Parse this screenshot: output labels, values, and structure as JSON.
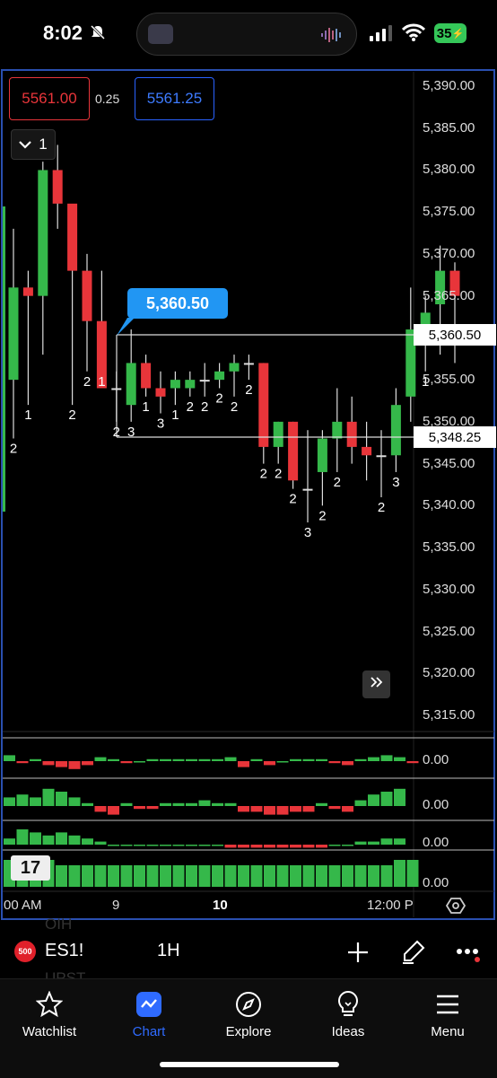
{
  "status_bar": {
    "time": "8:02",
    "battery": "35"
  },
  "chart": {
    "bid_price": "5561.00",
    "tick_size": "0.25",
    "ask_price": "5561.25",
    "collapse_label": "1",
    "price_labels": [
      "5,390.00",
      "5,385.00",
      "5,380.00",
      "5,375.00",
      "5,370.00",
      "5,365.00",
      "5,360.00",
      "5,355.00",
      "5,350.00",
      "5,345.00",
      "5,340.00",
      "5,335.00",
      "5,330.00",
      "5,325.00",
      "5,320.00",
      "5,315.00"
    ],
    "highlight_upper": "5,360.50",
    "highlight_lower": "5,348.25",
    "callout": "5,360.50",
    "candle_counts": [
      "2",
      "1",
      "2",
      "2",
      "1",
      "2",
      "3",
      "1",
      "3",
      "1",
      "2",
      "2",
      "2",
      "2",
      "2",
      "2",
      "2",
      "2",
      "3",
      "2",
      "2",
      "2",
      "3",
      "1"
    ],
    "indicator_values": [
      "0.00",
      "0.00",
      "0.00",
      "0.00"
    ],
    "time_labels": [
      "00 AM",
      "9",
      "10",
      "12:00 P"
    ],
    "colors": {
      "up": "#35b84a",
      "down": "#e8353a",
      "accent": "#2962ff",
      "callout": "#2196f3"
    },
    "ohlc": [
      [
        5355,
        5373,
        5348,
        5366
      ],
      [
        5366,
        5368,
        5352,
        5365
      ],
      [
        5365,
        5381,
        5358,
        5380
      ],
      [
        5380,
        5383,
        5373,
        5376
      ],
      [
        5376,
        5375,
        5352,
        5368
      ],
      [
        5368,
        5370,
        5356,
        5362
      ],
      [
        5362,
        5368,
        5356,
        5354
      ],
      [
        5354,
        5356,
        5350,
        5354
      ],
      [
        5352,
        5361,
        5350,
        5357
      ],
      [
        5357,
        5358,
        5353,
        5354
      ],
      [
        5354,
        5356,
        5351,
        5353
      ],
      [
        5354,
        5356,
        5352,
        5355
      ],
      [
        5354,
        5356,
        5353,
        5355
      ],
      [
        5355,
        5357,
        5353,
        5355
      ],
      [
        5355,
        5357,
        5354,
        5356
      ],
      [
        5356,
        5358,
        5353,
        5357
      ],
      [
        5357,
        5358,
        5355,
        5357
      ],
      [
        5357,
        5357,
        5345,
        5347
      ],
      [
        5347,
        5350,
        5345,
        5350
      ],
      [
        5350,
        5350,
        5342,
        5343
      ],
      [
        5342,
        5349,
        5338,
        5342
      ],
      [
        5344,
        5349,
        5340,
        5348
      ],
      [
        5348,
        5354,
        5344,
        5350
      ],
      [
        5350,
        5353,
        5345,
        5347
      ],
      [
        5347,
        5350,
        5343,
        5346
      ],
      [
        5346,
        5349,
        5341,
        5346
      ],
      [
        5346,
        5354,
        5344,
        5352
      ],
      [
        5353,
        5366,
        5350,
        5361
      ],
      [
        5361,
        5365,
        5356,
        5363
      ],
      [
        5364,
        5371,
        5358,
        5368
      ],
      [
        5368,
        5369,
        5357,
        5365
      ]
    ],
    "osc1": [
      3,
      -1,
      1,
      -2,
      -3,
      -4,
      -2,
      2,
      1,
      -1,
      0,
      1,
      1,
      1,
      1,
      1,
      1,
      2,
      -3,
      1,
      -2,
      0,
      1,
      1,
      1,
      -1,
      -2,
      1,
      2,
      3,
      2,
      -1
    ],
    "osc2": [
      3,
      4,
      3,
      6,
      5,
      3,
      1,
      -2,
      -3,
      1,
      -1,
      -1,
      1,
      1,
      1,
      2,
      1,
      1,
      -2,
      -2,
      -3,
      -3,
      -2,
      -2,
      1,
      -1,
      -2,
      2,
      4,
      5,
      6
    ],
    "osc3": [
      2,
      5,
      4,
      3,
      4,
      3,
      2,
      1,
      0,
      0,
      0,
      0,
      0,
      0,
      0,
      0,
      0,
      -1,
      -1,
      -1,
      -1,
      -1,
      -1,
      -1,
      -1,
      0,
      0,
      1,
      1,
      2,
      2
    ],
    "volume": [
      5,
      5,
      5,
      5,
      4,
      4,
      4,
      4,
      4,
      4,
      4,
      4,
      4,
      4,
      4,
      4,
      4,
      4,
      4,
      4,
      4,
      4,
      4,
      4,
      4,
      4,
      4,
      4,
      4,
      4,
      5,
      5
    ]
  },
  "toolbar": {
    "symbol_badge": "500",
    "symbol": "ES1!",
    "interval": "1H",
    "ghost_1": "OIH",
    "ghost_2": "UPST"
  },
  "tabs": [
    {
      "label": "Watchlist",
      "icon": "star-icon"
    },
    {
      "label": "Chart",
      "icon": "chart-icon"
    },
    {
      "label": "Explore",
      "icon": "compass-icon"
    },
    {
      "label": "Ideas",
      "icon": "bulb-icon"
    },
    {
      "label": "Menu",
      "icon": "menu-icon"
    }
  ]
}
